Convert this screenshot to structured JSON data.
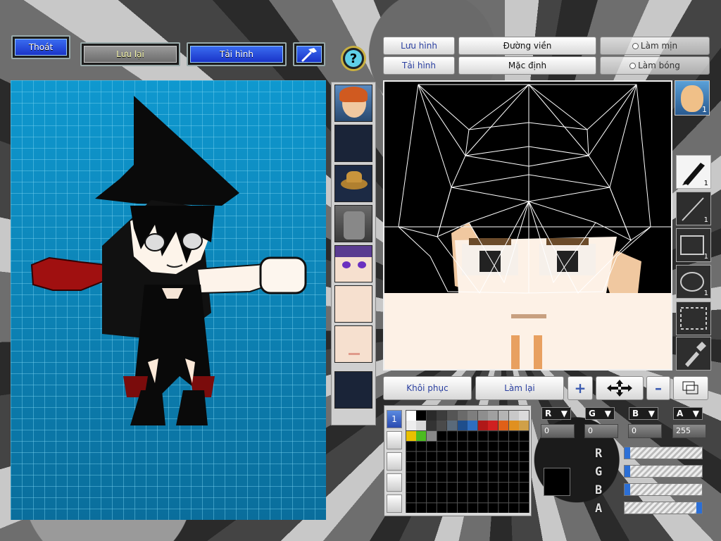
{
  "top_buttons": {
    "exit": "Thoát",
    "save": "Lưu lại",
    "reload": "Tải hình"
  },
  "editor_tabs": {
    "save_image": "Lưu hình",
    "load_image": "Tải hình",
    "outline": "Đường viền",
    "default": "Mặc định",
    "smooth": "Làm mịn",
    "shade": "Làm bóng"
  },
  "tools": [
    {
      "icon": "pen-icon",
      "count": "1"
    },
    {
      "icon": "line-icon",
      "count": "1"
    },
    {
      "icon": "rectangle-icon",
      "count": "1"
    },
    {
      "icon": "ellipse-icon",
      "count": "1"
    },
    {
      "icon": "select-icon",
      "count": ""
    },
    {
      "icon": "eyedropper-icon",
      "count": ""
    }
  ],
  "face_badge_count": "1",
  "action_buttons": {
    "restore": "Khôi phục",
    "redo": "Làm lại"
  },
  "palette": {
    "row1": [
      "#ffffff",
      "#000000",
      "#2a2a2a",
      "#3c3c3c",
      "#555555",
      "#6a6a6a",
      "#7e7e7e",
      "#8e8e8e",
      "#a0a0a0",
      "#b4b4b4",
      "#c8c8c8",
      "#dadada"
    ],
    "row2": [
      "#eeeeee",
      "#d8d8d8",
      "#333333",
      "#4a4a4a",
      "#5a6a7a",
      "#1f4e8c",
      "#2f6ec0",
      "#b01818",
      "#d02020",
      "#e06018",
      "#e09020",
      "#d0a048"
    ],
    "row3": [
      "#e8c000",
      "#4cbb20",
      "#888888"
    ]
  },
  "layer_tab": "1",
  "color_channels": {
    "labels": [
      "R",
      "G",
      "B",
      "A"
    ],
    "values": [
      "0",
      "0",
      "0",
      "255"
    ],
    "slider_labels": [
      "R",
      "G",
      "B",
      "A"
    ],
    "levels": [
      0,
      0,
      0,
      1
    ],
    "current_color": "#000000"
  },
  "colors": {
    "accent_blue": "#1f3fd8",
    "canvas_blue": "#0f8cc0"
  }
}
